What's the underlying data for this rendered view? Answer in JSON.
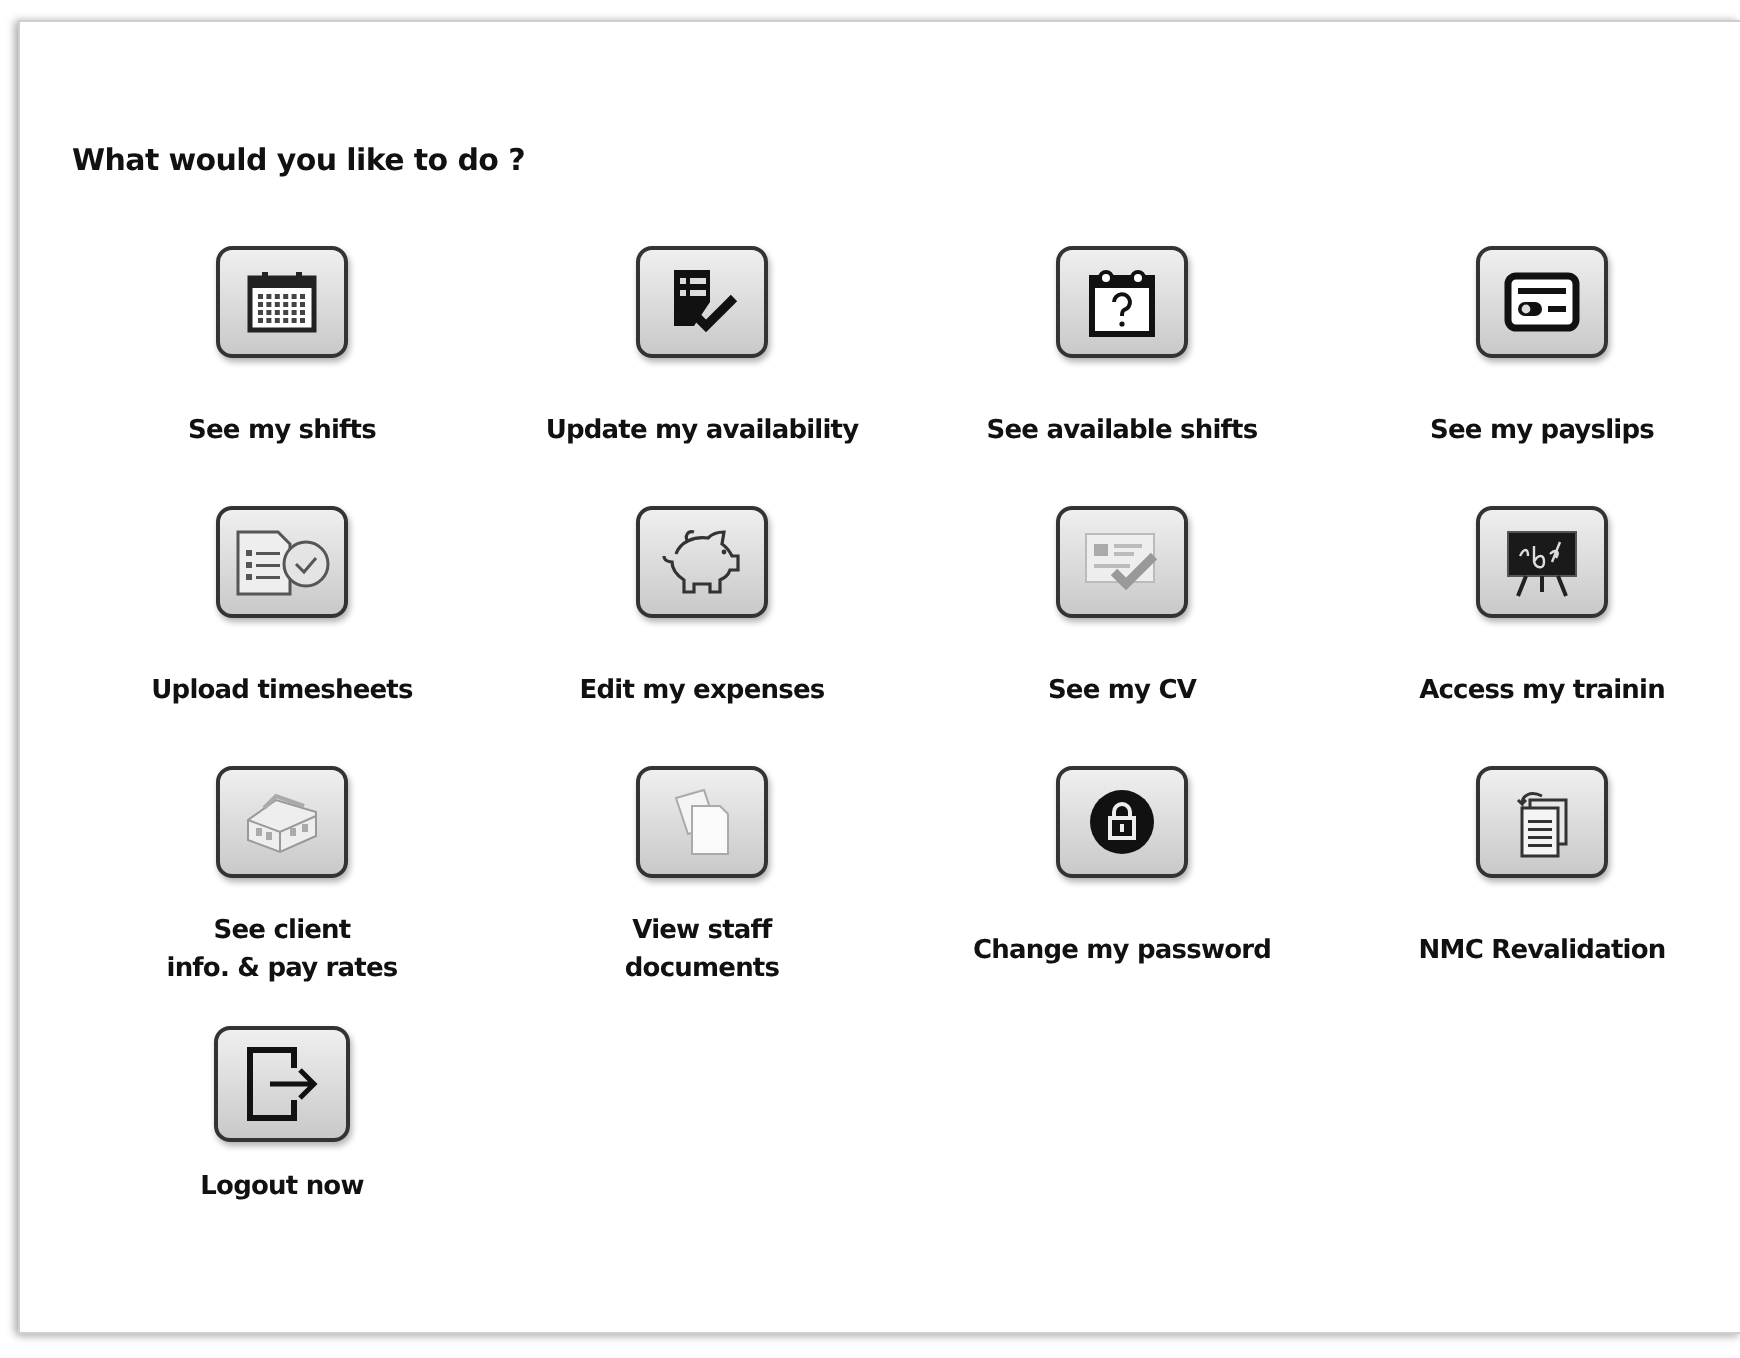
{
  "heading": "What would you like to do ?",
  "actions": [
    {
      "label": "See my shifts"
    },
    {
      "label": "Update my availability"
    },
    {
      "label": "See available shifts"
    },
    {
      "label": "See my payslips"
    },
    {
      "label": "Upload timesheets"
    },
    {
      "label": "Edit my expenses"
    },
    {
      "label": "See my CV"
    },
    {
      "label": "Access my trainin"
    },
    {
      "label": "See client\ninfo. & pay rates"
    },
    {
      "label": "View staff\ndocuments"
    },
    {
      "label": "Change my password"
    },
    {
      "label": "NMC Revalidation"
    },
    {
      "label": "Logout now"
    }
  ]
}
